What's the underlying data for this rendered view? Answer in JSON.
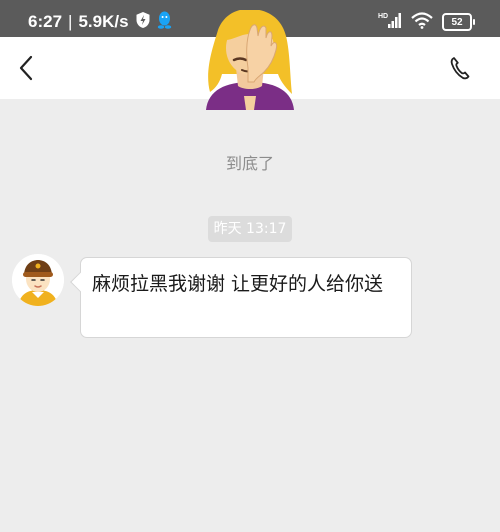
{
  "status_bar": {
    "time": "6:27",
    "separator": "|",
    "net_speed": "5.9K/s",
    "signal_label": "HD",
    "battery": "52"
  },
  "nav": {
    "back_icon": "chevron-left-icon",
    "call_icon": "phone-icon"
  },
  "header_avatar": "facepalm-woman-emoji",
  "chat": {
    "bottom_label": "到底了",
    "timestamp": "昨天 13:17",
    "messages": [
      {
        "sender": "incoming",
        "text": "麻烦拉黑我谢谢 让更好的人给你送"
      }
    ]
  },
  "colors": {
    "status_bar_bg": "#5b5b5b",
    "chat_bg": "#ededed",
    "bubble_bg": "#ffffff",
    "qq_blue": "#1aa3f5",
    "rider_yellow": "#f0b11e"
  }
}
